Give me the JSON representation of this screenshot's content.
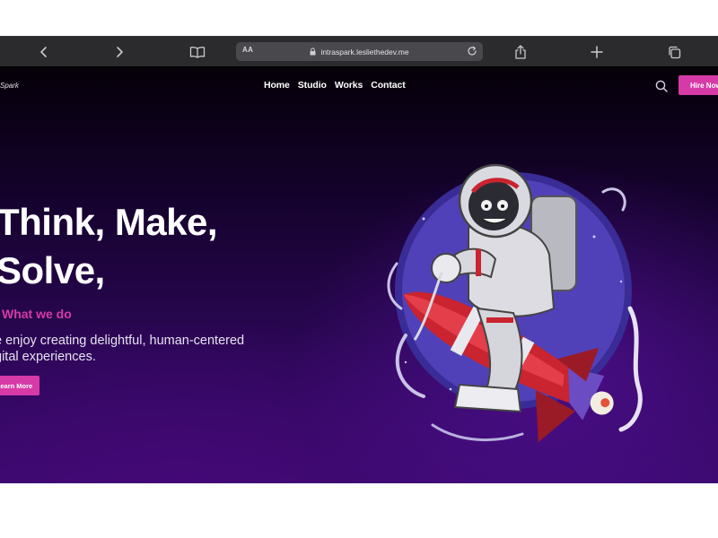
{
  "browser": {
    "url_aa": "AA",
    "url": "intraspark.lesliethedev.me",
    "icons": {
      "back": "chevron-left-icon",
      "forward": "chevron-right-icon",
      "bookmarks": "book-icon",
      "lock": "lock-icon",
      "reload": "reload-icon",
      "share": "share-icon",
      "new_tab": "plus-icon",
      "tabs": "tabs-icon"
    }
  },
  "site": {
    "logo": "Spark",
    "nav": [
      "Home",
      "Studio",
      "Works",
      "Contact"
    ],
    "hire_button": "Hire Now",
    "search_icon": "search-icon"
  },
  "hero": {
    "headline_line1": "Think, Make,",
    "headline_line2": "Solve,",
    "kicker": "What we do",
    "lead_line1": "e enjoy creating delightful, human-centered",
    "lead_line2": "gital experiences.",
    "cta": "Learn More",
    "illustration": "astronaut-riding-rocket-illustration"
  },
  "colors": {
    "accent": "#d63aa6",
    "background_dark": "#050008",
    "background_purple": "#3a0a6e",
    "browser_chrome": "#2b2b2e"
  }
}
